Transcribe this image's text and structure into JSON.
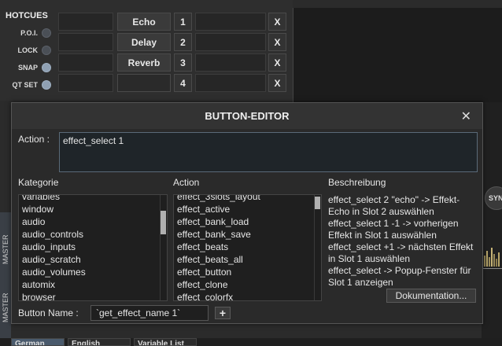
{
  "hotcues": {
    "title": "HOTCUES",
    "options": [
      {
        "label": "P.O.I.",
        "on": false
      },
      {
        "label": "LOCK",
        "on": false
      },
      {
        "label": "SNAP",
        "on": true
      },
      {
        "label": "QT SET",
        "on": true
      }
    ]
  },
  "fx_slots": [
    {
      "name": "Echo",
      "num": "1",
      "clear": "X"
    },
    {
      "name": "Delay",
      "num": "2",
      "clear": "X"
    },
    {
      "name": "Reverb",
      "num": "3",
      "clear": "X"
    },
    {
      "name": "",
      "num": "4",
      "clear": "X"
    }
  ],
  "deck": {
    "sync_label": "SYN",
    "side_label_1": "MASTER",
    "side_label_2": "MASTER"
  },
  "bottom_tabs": [
    {
      "label": "German",
      "active": true
    },
    {
      "label": "English",
      "active": false
    },
    {
      "label": "Variable List",
      "active": false
    }
  ],
  "dialog": {
    "title": "BUTTON-EDITOR",
    "close": "✕",
    "action_label": "Action :",
    "action_value": "effect_select 1",
    "headers": {
      "category": "Kategorie",
      "action": "Action",
      "description": "Beschreibung"
    },
    "categories": [
      "variables",
      "window",
      "audio",
      "audio_controls",
      "audio_inputs",
      "audio_scratch",
      "audio_volumes",
      "automix",
      "browser"
    ],
    "actions": [
      "effect_3slots_layout",
      "effect_active",
      "effect_bank_load",
      "effect_bank_save",
      "effect_beats",
      "effect_beats_all",
      "effect_button",
      "effect_clone",
      "effect_colorfx"
    ],
    "description": [
      "effect_select 2 \"echo\" -> Effekt-Echo in Slot 2 auswählen",
      "effect_select 1 -1 -> vorherigen Effekt in Slot 1 auswählen",
      "effect_select +1 -> nächsten Effekt in Slot 1 auswählen",
      "effect_select -> Popup-Fenster für Slot 1 anzeigen"
    ],
    "doc_button": "Dokumentation...",
    "button_name_label": "Button Name :",
    "button_name_value": "`get_effect_name 1`",
    "plus": "+"
  }
}
